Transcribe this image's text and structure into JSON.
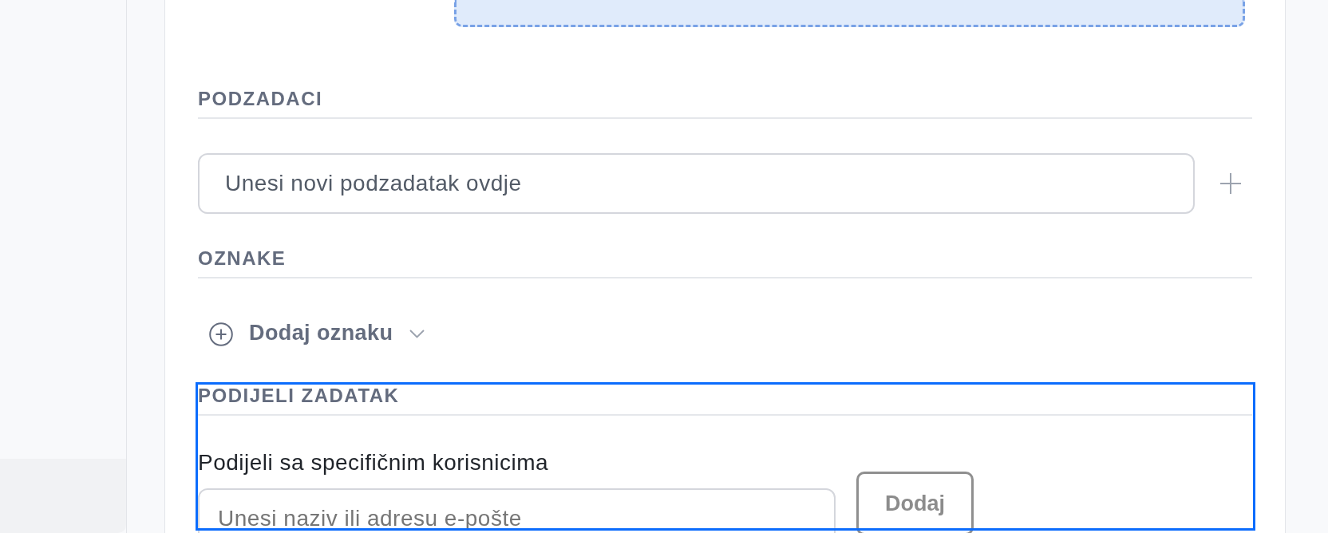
{
  "subtasks": {
    "heading": "PODZADACI",
    "input": {
      "placeholder": "Unesi novi podzadatak ovdje"
    }
  },
  "tags": {
    "heading": "OZNAKE",
    "add_button": {
      "label": "Dodaj oznaku"
    }
  },
  "share": {
    "highlighted": true,
    "heading": "PODIJELI ZADATAK",
    "label": "Podijeli sa specifičnim korisnicima",
    "input": {
      "placeholder": "Unesi naziv ili adresu e-pošte"
    },
    "button": {
      "label": "Dodaj"
    }
  }
}
